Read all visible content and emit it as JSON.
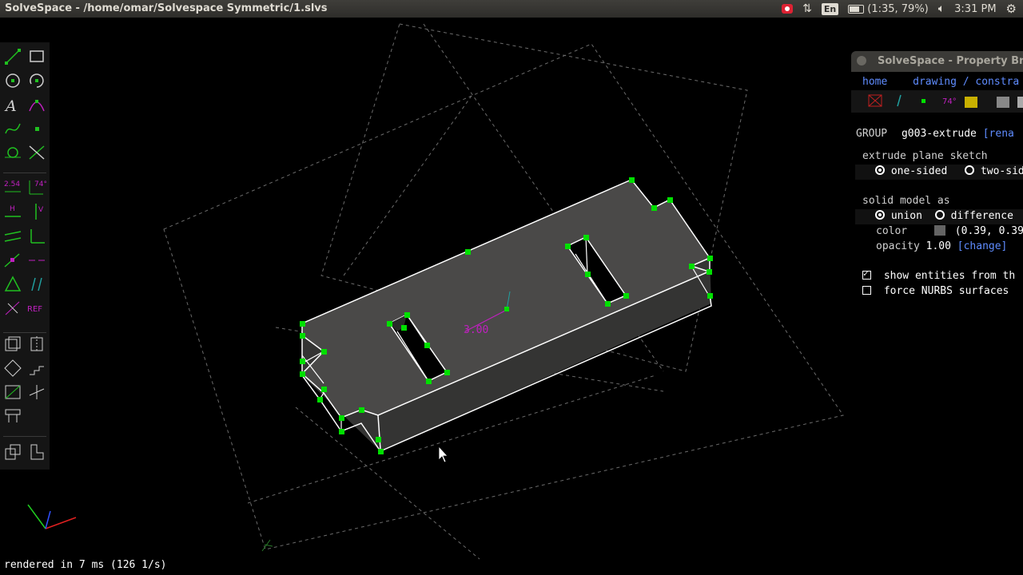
{
  "window": {
    "title": "SolveSpace - /home/omar/Solvespace Symmetric/1.slvs"
  },
  "tray": {
    "keyboard": "En",
    "battery": "(1:35, 79%)",
    "clock": "3:31 PM"
  },
  "property_browser": {
    "title": "SolveSpace - Property Brow",
    "nav_home": "home",
    "nav_path": "drawing / constra",
    "group_label": "GROUP",
    "group_name": "g003-extrude",
    "group_rename": "[rena",
    "extrude_heading": "extrude plane sketch",
    "opt_one_sided": "one-sided",
    "opt_two_sided": "two-sid",
    "solid_heading": "solid model as",
    "opt_union": "union",
    "opt_difference": "difference",
    "color_label": "color",
    "color_value": "(0.39, 0.39",
    "opacity_label": "opacity",
    "opacity_value": "1.00",
    "opacity_change": "[change]",
    "show_entities": "show entities from th",
    "force_nurbs": "force NURBS surfaces"
  },
  "drawing": {
    "dimension_label": "3.00"
  },
  "toolbar_icons": [
    "line-tool-icon",
    "rectangle-tool-icon",
    "circle-tool-icon",
    "arc-tool-icon",
    "text-tool-icon",
    "tangent-arc-tool-icon",
    "bezier-tool-icon",
    "point-tool-icon",
    "workplane-tool-icon",
    "split-curves-icon",
    "distance-constraint-icon",
    "angle-constraint-icon",
    "horizontal-constraint-icon",
    "vertical-constraint-icon",
    "parallel-constraint-icon",
    "perpendicular-constraint-icon",
    "point-on-line-icon",
    "symmetric-constraint-icon",
    "equal-constraint-icon",
    "orientation-constraint-icon",
    "other-supplementary-icon",
    "reference-toggle-icon",
    "extrude-icon",
    "lathe-icon",
    "step-rotate-icon",
    "step-translate-icon",
    "workplane-group-icon",
    "new-group-icon",
    "sketch-in-3d-icon",
    "assemble-icon",
    "sketch-in-plane-icon"
  ],
  "toolbar_text": {
    "distance": "2.54",
    "angle": "74°",
    "horizontal": "H",
    "vertical": "V",
    "ref": "REF"
  },
  "status": {
    "render_time": "rendered in 7 ms (126 1/s)"
  },
  "colors": {
    "point": "#00e000",
    "edge": "#ffffff",
    "face": "#4a4948",
    "construction": "#6b6b6b",
    "dimension": "#c020c0",
    "link": "#5f8cff",
    "axis_x": "#e02020",
    "axis_y": "#20d020",
    "axis_z": "#3050ff"
  }
}
